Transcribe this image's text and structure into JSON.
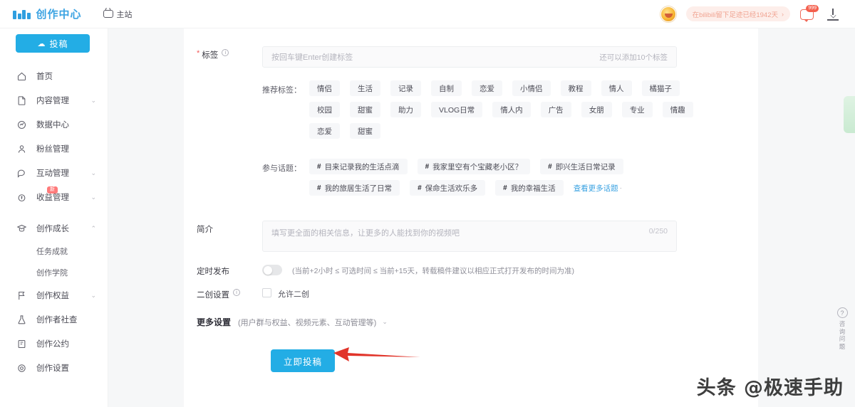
{
  "topbar": {
    "brand": "创作中心",
    "nav_main_site": "主站",
    "signin_pill": "在bilibili留下足迹已经1942天",
    "signin_chevron": "›",
    "message_badge": "999",
    "icons": {
      "tv": "tv-icon",
      "avatar": "avatar",
      "message": "message-icon",
      "download": "download-icon"
    }
  },
  "sidebar": {
    "post_button": "投稿",
    "post_icon": "☁",
    "items": [
      {
        "label": "首页",
        "icon": "home-icon",
        "expandable": false
      },
      {
        "label": "内容管理",
        "icon": "file-icon",
        "expandable": true
      },
      {
        "label": "数据中心",
        "icon": "chart-icon",
        "expandable": false
      },
      {
        "label": "粉丝管理",
        "icon": "user-icon",
        "expandable": false
      },
      {
        "label": "互动管理",
        "icon": "comment-icon",
        "expandable": true
      },
      {
        "label": "收益管理",
        "icon": "coin-icon",
        "expandable": true,
        "badge": "新"
      }
    ],
    "group": {
      "label": "创作成长",
      "icon": "graduation-icon",
      "expandable": true,
      "expanded": true,
      "children": [
        "任务成就",
        "创作学院"
      ]
    },
    "items2": [
      {
        "label": "创作权益",
        "icon": "flag-icon",
        "expandable": true
      },
      {
        "label": "创作者社查",
        "icon": "lab-icon",
        "expandable": false
      },
      {
        "label": "创作公约",
        "icon": "book-icon",
        "expandable": false
      },
      {
        "label": "创作设置",
        "icon": "settings-icon",
        "expandable": false
      }
    ]
  },
  "form": {
    "tag": {
      "label": "标签",
      "required_mark": "*",
      "info_icon": "ⓘ",
      "placeholder": "按回车键Enter创建标签",
      "counter": "还可以添加10个标签"
    },
    "recommend_tags": {
      "label": "推荐标签：",
      "chips": [
        "情侣",
        "生活",
        "记录",
        "自制",
        "恋爱",
        "小情侣",
        "教程",
        "情人",
        "橘猫子",
        "校园",
        "甜蜜",
        "助力",
        "VLOG日常",
        "情人内",
        "广告",
        "女朋",
        "专业",
        "情趣",
        "恋爱",
        "甜蜜"
      ]
    },
    "topics": {
      "label": "参与话题：",
      "chips": [
        "目来记录我的生活点滴",
        "我家里空有个宝藏老小区？",
        "即兴生活日常记录",
        "我的旅居生活了日常",
        "保命生活欢乐多",
        "我的幸福生活"
      ],
      "hash": "#",
      "more_link": "查看更多话题",
      "more_dot": "·"
    },
    "desc": {
      "label": "简介",
      "placeholder": "填写更全面的相关信息，让更多的人能找到你的视频吧",
      "counter": "0/250"
    },
    "schedule": {
      "label": "定时发布",
      "toggle_on": false,
      "hint": "(当前+2小时 ≤ 可选时间 ≤ 当前+15天，转载稿件建议以相应正式打开发布的时间为准)"
    },
    "secondary": {
      "label": "二创设置",
      "info_icon": "ⓘ",
      "checkbox_label": "允许二创",
      "checked": false
    },
    "more": {
      "title": "更多设置",
      "sub": "(用户群与权益、视频元素、互动管理等)",
      "caret": "⌄"
    },
    "submit": "立即投稿"
  },
  "rail": {
    "help_icon": "?",
    "help_text": "咨询问题"
  },
  "watermark": "头条 @极速手助",
  "colors": {
    "brand_blue": "#23ade5",
    "link_blue": "#3ba3e2",
    "panel_bg": "#f6f7f8",
    "chip_bg": "#f6f7f9",
    "arrow_red": "#e1342a",
    "badge_red": "#f4604e",
    "required_red": "#f25b5b"
  }
}
